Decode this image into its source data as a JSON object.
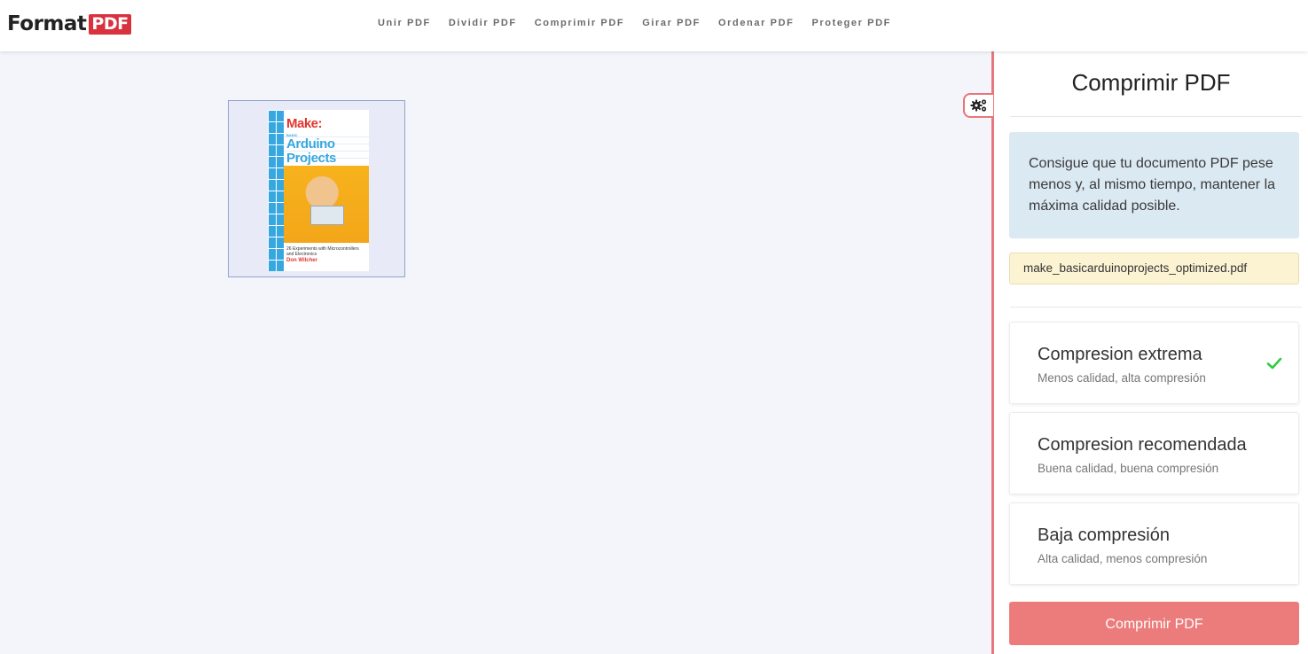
{
  "brand": {
    "logo_word": "Format",
    "logo_badge": "PDF",
    "accent_color": "#d9313e"
  },
  "nav": {
    "items": [
      {
        "label": "Unir PDF"
      },
      {
        "label": "Dividir PDF"
      },
      {
        "label": "Comprimir PDF"
      },
      {
        "label": "Girar PDF"
      },
      {
        "label": "Ordenar PDF"
      },
      {
        "label": "Proteger PDF"
      }
    ]
  },
  "document": {
    "cover": {
      "make": "Make:",
      "basic": "BASIC",
      "title_line1": "Arduino",
      "title_line2": "Projects",
      "subtitle": "26 Experiments with Microcontrollers and Electronics",
      "author": "Don Wilcher"
    }
  },
  "sidebar": {
    "settings_icon": "gears-icon",
    "title": "Comprimir PDF",
    "info_text": "Consigue que tu documento PDF pese menos y, al mismo tiempo, mantener la máxima calidad posible.",
    "filename": "make_basicarduinoprojects_optimized.pdf",
    "options": [
      {
        "title": "Compresion extrema",
        "subtitle": "Menos calidad, alta compresión",
        "selected": true
      },
      {
        "title": "Compresion recomendada",
        "subtitle": "Buena calidad, buena compresión",
        "selected": false
      },
      {
        "title": "Baja compresión",
        "subtitle": "Alta calidad, menos compresión",
        "selected": false
      }
    ],
    "submit_label": "Comprimir PDF",
    "accent_color": "#ec7b7b",
    "check_color": "#2ecc40"
  }
}
